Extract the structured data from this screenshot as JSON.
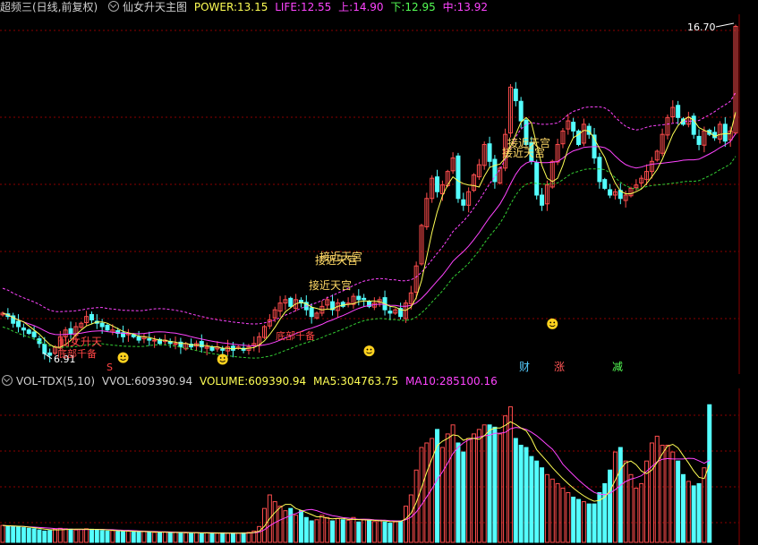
{
  "header": {
    "title": "超频三(日线,前复权)",
    "indicator_name": "仙女升天主图",
    "power_label": "POWER:",
    "power_value": "13.15",
    "life_label": "LIFE:",
    "life_value": "12.55",
    "up_label": "上:",
    "up_value": "14.90",
    "down_label": "下:",
    "down_value": "12.95",
    "mid_label": "中:",
    "mid_value": "13.92"
  },
  "price_panel": {
    "high_label": "16.70",
    "low_label": "6.91",
    "signal_labels": {
      "near_palace_1": "接近天宫",
      "near_palace_2": "接近天宫",
      "near_palace_3": "接近天宫",
      "near_palace_4": "接近天宫",
      "near_palace_5": "接近天宫",
      "xiannv": "仙女升天",
      "dipan": "底部千备",
      "dipan_2": "底部千备",
      "s_mark": "S"
    },
    "badges": {
      "cai": "财",
      "zhang": "涨",
      "jian": "减"
    }
  },
  "volume_header": {
    "name": "VOL-TDX(5,10)",
    "vvol_label": "VVOL:",
    "vvol_value": "609390.94",
    "volume_label": "VOLUME:",
    "volume_value": "609390.94",
    "ma5_label": "MA5:",
    "ma5_value": "304763.75",
    "ma10_label": "MA10:",
    "ma10_value": "285100.16"
  },
  "colors": {
    "up": "#ff4d4d",
    "down": "#54ffff",
    "ma_yellow": "#ffff55",
    "ma_magenta": "#ff44ff",
    "grid": "#8b0000",
    "support": "#33cc33"
  },
  "chart_data": {
    "type": "candlestick",
    "price_range": [
      6.5,
      16.9
    ],
    "close": [
      8.2,
      8.1,
      7.9,
      7.8,
      7.7,
      7.6,
      7.5,
      7.3,
      7.0,
      6.95,
      7.2,
      7.5,
      7.7,
      7.6,
      7.8,
      7.9,
      8.1,
      8.0,
      7.9,
      7.8,
      7.7,
      7.7,
      7.6,
      7.5,
      7.6,
      7.5,
      7.4,
      7.5,
      7.4,
      7.4,
      7.3,
      7.4,
      7.3,
      7.3,
      7.2,
      7.3,
      7.2,
      7.3,
      7.2,
      7.2,
      7.1,
      7.2,
      7.1,
      7.2,
      7.1,
      7.2,
      7.1,
      7.2,
      7.3,
      7.5,
      7.8,
      8.0,
      8.3,
      8.5,
      8.6,
      8.4,
      8.6,
      8.5,
      8.3,
      8.1,
      8.2,
      8.4,
      8.6,
      8.3,
      8.5,
      8.4,
      8.5,
      8.7,
      8.6,
      8.6,
      8.4,
      8.5,
      8.6,
      8.3,
      8.2,
      8.3,
      8.1,
      8.5,
      8.8,
      9.6,
      10.8,
      11.6,
      12.2,
      11.8,
      12.0,
      12.4,
      12.8,
      11.6,
      11.4,
      11.8,
      12.3,
      12.6,
      13.2,
      12.7,
      12.1,
      12.5,
      13.5,
      14.9,
      14.5,
      13.9,
      13.2,
      12.7,
      11.7,
      11.4,
      12.0,
      12.7,
      13.2,
      13.6,
      13.9,
      13.6,
      13.2,
      13.8,
      13.5,
      12.8,
      12.1,
      11.9,
      11.7,
      11.8,
      11.6,
      11.7,
      11.9,
      12.0,
      12.2,
      12.4,
      12.7,
      13.0,
      13.5,
      14.0,
      14.3,
      14.0,
      13.8,
      14.0,
      13.5,
      13.2,
      13.6,
      13.5,
      13.4,
      13.8,
      13.3,
      13.6,
      16.7
    ],
    "volume": [
      75000,
      72000,
      70000,
      68000,
      65000,
      62000,
      60000,
      55000,
      50000,
      52000,
      58000,
      62000,
      60000,
      58000,
      55000,
      57000,
      60000,
      58000,
      55000,
      52000,
      50000,
      52000,
      48000,
      50000,
      49000,
      47000,
      46000,
      48000,
      45000,
      44000,
      43000,
      45000,
      42000,
      44000,
      43000,
      42000,
      41000,
      43000,
      40000,
      42000,
      41000,
      40000,
      42000,
      40000,
      41000,
      40000,
      42000,
      44000,
      50000,
      70000,
      150000,
      210000,
      180000,
      160000,
      140000,
      150000,
      120000,
      140000,
      110000,
      95000,
      100000,
      120000,
      110000,
      95000,
      105000,
      100000,
      98000,
      110000,
      90000,
      100000,
      95000,
      92000,
      98000,
      90000,
      85000,
      92000,
      95000,
      160000,
      210000,
      320000,
      420000,
      440000,
      460000,
      500000,
      420000,
      480000,
      520000,
      440000,
      400000,
      460000,
      480000,
      500000,
      520000,
      520000,
      510000,
      480000,
      560000,
      600000,
      460000,
      430000,
      420000,
      380000,
      360000,
      330000,
      300000,
      280000,
      260000,
      240000,
      220000,
      200000,
      190000,
      180000,
      170000,
      170000,
      220000,
      260000,
      320000,
      400000,
      420000,
      360000,
      300000,
      240000,
      260000,
      360000,
      440000,
      470000,
      430000,
      430000,
      400000,
      360000,
      300000,
      270000,
      250000,
      260000,
      330000,
      609390
    ]
  }
}
